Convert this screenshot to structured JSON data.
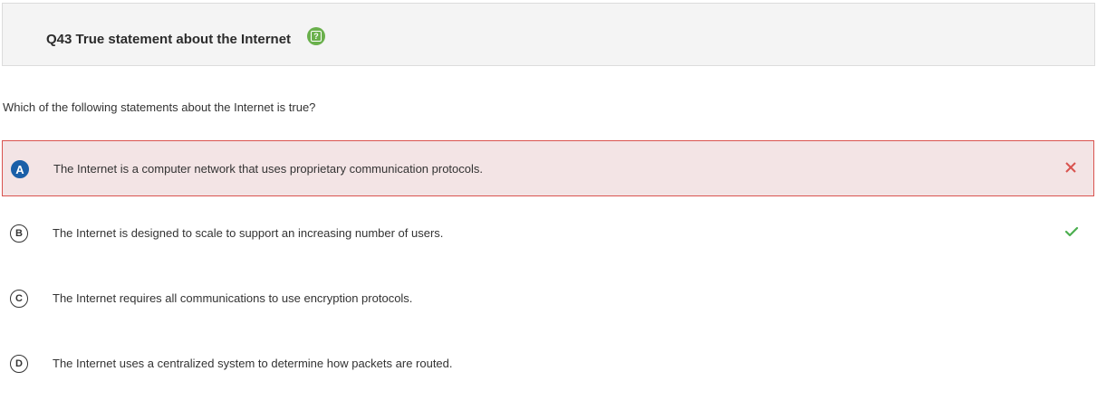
{
  "header": {
    "title": "Q43 True statement about the Internet",
    "help_icon": "help-icon",
    "help_glyph": "?",
    "help_color": "#6ab04c"
  },
  "question": {
    "text": "Which of the following statements about the Internet is true?"
  },
  "options": [
    {
      "letter": "A",
      "text": "The Internet is a computer network that uses proprietary communication protocols.",
      "selected": true,
      "status": "incorrect",
      "status_icon": "cross-icon"
    },
    {
      "letter": "B",
      "text": "The Internet is designed to scale to support an increasing number of users.",
      "selected": false,
      "status": "correct",
      "status_icon": "check-icon"
    },
    {
      "letter": "C",
      "text": "The Internet requires all communications to use encryption protocols.",
      "selected": false,
      "status": ""
    },
    {
      "letter": "D",
      "text": "The Internet uses a centralized system to determine how packets are routed.",
      "selected": false,
      "status": ""
    }
  ],
  "colors": {
    "selected_letter_bg": "#1a5fa8",
    "incorrect_bg": "#f3e4e5",
    "incorrect_border": "#d9534f",
    "cross": "#d9534f",
    "check": "#4caf50"
  }
}
